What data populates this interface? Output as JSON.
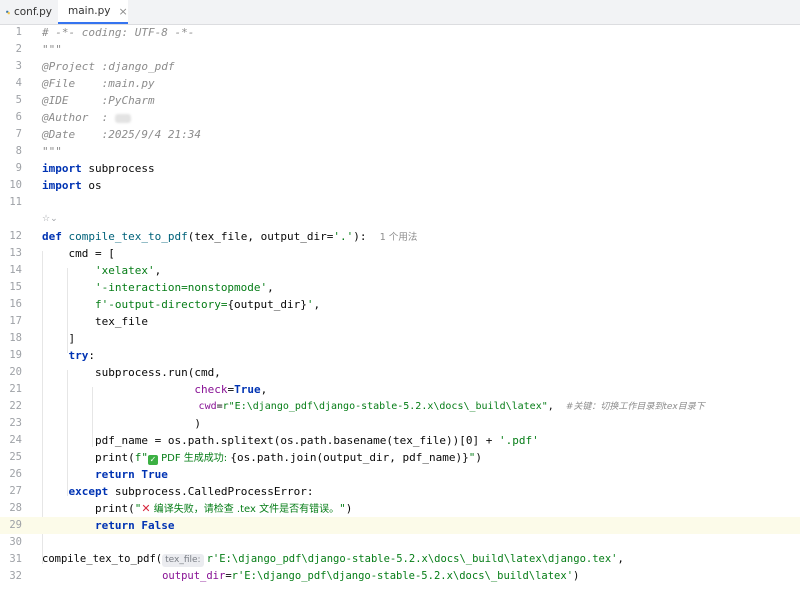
{
  "tabs": [
    {
      "label": "conf.py",
      "active": false
    },
    {
      "label": "main.py",
      "active": true,
      "close": "×"
    }
  ],
  "code": {
    "l1": "# -*- coding: UTF-8 -*-",
    "l2": "\"\"\"",
    "l3": "@Project :django_pdf",
    "l4": "@File    :main.py",
    "l5": "@IDE     :PyCharm",
    "l6": "@Author  :",
    "l7": "@Date    :2025/9/4 21:34",
    "l8": "\"\"\"",
    "l9_kw": "import",
    "l9_rest": " subprocess",
    "l10_kw": "import",
    "l10_rest": " os",
    "ai": "☆⌄",
    "l12_kw": "def",
    "l12_fn": " compile_tex_to_pdf",
    "l12_rest": "(tex_file, output_dir=",
    "l12_str": "'.'",
    "l12_end": "):",
    "l12_hint": "1 个用法",
    "l13": "    cmd = [",
    "l14": "'xelatex'",
    "l15": "'-interaction=nonstopmode'",
    "l16a": "f'-output-directory=",
    "l16b": "{output_dir}",
    "l16c": "'",
    "l17": "        tex_file",
    "l18": "    ]",
    "l19_kw": "try",
    "l20": "        subprocess.run(cmd,",
    "l21_param": "check",
    "l21_kw": "True",
    "l22_param": "cwd",
    "l22_str": "r\"E:\\django_pdf\\django-stable-5.2.x\\docs\\_build\\latex\"",
    "l22_cm": "#关键：切换工作目录到tex目录下",
    "l23": "                       )",
    "l24a": "        pdf_name = os.path.splitext(os.path.basename(tex_file))[0] + ",
    "l24_str": "'.pdf'",
    "l25a": "        print(",
    "l25_str1": "f\"",
    "l25_check": "✓",
    "l25_cn": " PDF 生成成功: ",
    "l25_rest": "{os.path.join(output_dir, pdf_name)}",
    "l25_str2": "\"",
    "l25_end": ")",
    "l26_kw": "return True",
    "l27_kw": "except",
    "l27_rest": " subprocess.CalledProcessError:",
    "l28a": "        print(",
    "l28_str1": "\"",
    "l28_x": "✕",
    "l28_cn": " 编译失败，请检查 .tex 文件是否有错误。",
    "l28_str2": "\"",
    "l28_end": ")",
    "l29_kw": "return False",
    "l31a": "compile_tex_to_pdf(",
    "l31_inlay": "tex_file:",
    "l31_str": "r'E:\\django_pdf\\django-stable-5.2.x\\docs\\_build\\latex\\django.tex'",
    "l31_end": ",",
    "l32_param": "output_dir",
    "l32_str": "r'E:\\django_pdf\\django-stable-5.2.x\\docs\\_build\\latex'",
    "l32_end": ")"
  },
  "line_numbers": [
    "1",
    "2",
    "3",
    "4",
    "5",
    "6",
    "7",
    "8",
    "9",
    "10",
    "11",
    "12",
    "13",
    "14",
    "15",
    "16",
    "17",
    "18",
    "19",
    "20",
    "21",
    "22",
    "23",
    "24",
    "25",
    "26",
    "27",
    "28",
    "29",
    "30",
    "31",
    "32"
  ]
}
